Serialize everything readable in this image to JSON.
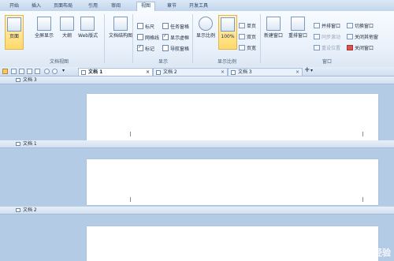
{
  "menubar": {
    "items": [
      "开始",
      "插入",
      "页面布局",
      "引用",
      "审阅",
      "视图",
      "章节",
      "开发工具"
    ],
    "active": "视图"
  },
  "ribbon": {
    "doc_views": {
      "buttons": [
        "页面",
        "全屏显示",
        "大纲",
        "Web版式",
        "文档结构图"
      ],
      "group_label": "文档视图"
    },
    "show": {
      "col1": [
        {
          "label": "标尺",
          "checked": false
        },
        {
          "label": "网格线",
          "checked": false
        },
        {
          "label": "标记",
          "checked": true
        }
      ],
      "col2": [
        {
          "label": "任务窗格",
          "checked": false
        },
        {
          "label": "显示虚框",
          "checked": true
        },
        {
          "label": "导航窗格",
          "checked": false
        }
      ],
      "group_label": "显示"
    },
    "zoom": {
      "buttons": [
        "显示比例",
        "100%"
      ],
      "small": [
        "单页",
        "双页",
        "页宽"
      ],
      "group_label": "显示比例"
    },
    "window": {
      "buttons": [
        "新建窗口",
        "重排窗口"
      ],
      "col1": [
        "并排窗口",
        "同步滚动",
        "重设位置"
      ],
      "col2": [
        "切换窗口",
        "关闭其他窗",
        "关闭窗口"
      ],
      "group_label": "窗口"
    }
  },
  "tabs": [
    {
      "label": "文档 1",
      "active": true
    },
    {
      "label": "文档 2",
      "active": false
    },
    {
      "label": "文档 3",
      "active": false
    }
  ],
  "panes": [
    "文档 3",
    "文档 1",
    "文档 2"
  ],
  "watermark": "Baidu经验"
}
